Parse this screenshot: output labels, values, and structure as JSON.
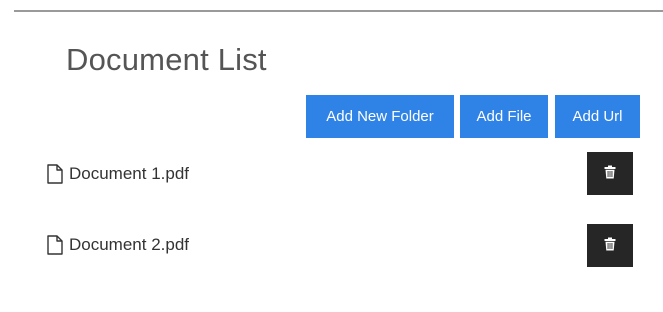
{
  "page": {
    "title": "Document List"
  },
  "toolbar": {
    "add_folder_label": "Add New Folder",
    "add_file_label": "Add File",
    "add_url_label": "Add Url"
  },
  "documents": [
    {
      "name": "Document 1.pdf",
      "icon": "file-icon",
      "action_icon": "trash-icon"
    },
    {
      "name": "Document 2.pdf",
      "icon": "file-icon",
      "action_icon": "trash-icon"
    }
  ],
  "colors": {
    "primary_button": "#2f82e6",
    "delete_button": "#262626",
    "rule": "#9a9a9a"
  }
}
